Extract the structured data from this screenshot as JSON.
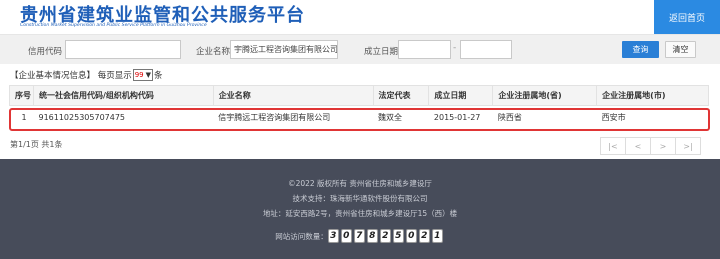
{
  "header": {
    "title_cn": "贵州省建筑业监管和公共服务平台",
    "title_en": "Construction Market Supervision and Public Service Platform in Guizhou Province",
    "home_button": "返回首页"
  },
  "search": {
    "credit_code_label": "信用代码",
    "credit_code_value": "",
    "company_name_label": "企业名称",
    "company_name_value": "宇腾远工程咨询集团有限公司",
    "date_label": "成立日期",
    "date_from": "",
    "date_sep": "-",
    "date_to": "",
    "query_button": "查询",
    "clear_button": "清空"
  },
  "info": {
    "prefix": "【企业基本情况信息】 每页显示",
    "page_size": "99",
    "suffix": "条"
  },
  "table": {
    "headers": [
      "序号",
      "统一社会信用代码/组织机构代码",
      "企业名称",
      "法定代表",
      "成立日期",
      "企业注册属地(省)",
      "企业注册属地(市)"
    ],
    "rows": [
      [
        "1",
        "91611025305707475",
        "信宇腾远工程咨询集团有限公司",
        "魏双全",
        "2015-01-27",
        "陕西省",
        "西安市"
      ]
    ]
  },
  "pagination": {
    "info": "第1/1页 共1条",
    "buttons": [
      "|<",
      "<",
      ">",
      ">|"
    ]
  },
  "footer": {
    "copyright": "©2022 版权所有 贵州省住房和城乡建设厅",
    "support": "技术支持：珠海新华通软件股份有限公司",
    "address": "地址：延安西路2号，贵州省住房和城乡建设厅15（西）楼",
    "visits_label": "网站访问数量：",
    "visit_digits": [
      "3",
      "0",
      "7",
      "8",
      "2",
      "5",
      "0",
      "2",
      "1"
    ]
  },
  "colors": {
    "brand": "#1f5fb8",
    "home_button": "#2b8ae2",
    "highlight": "#e03535",
    "footer_bg": "#474c5a"
  }
}
